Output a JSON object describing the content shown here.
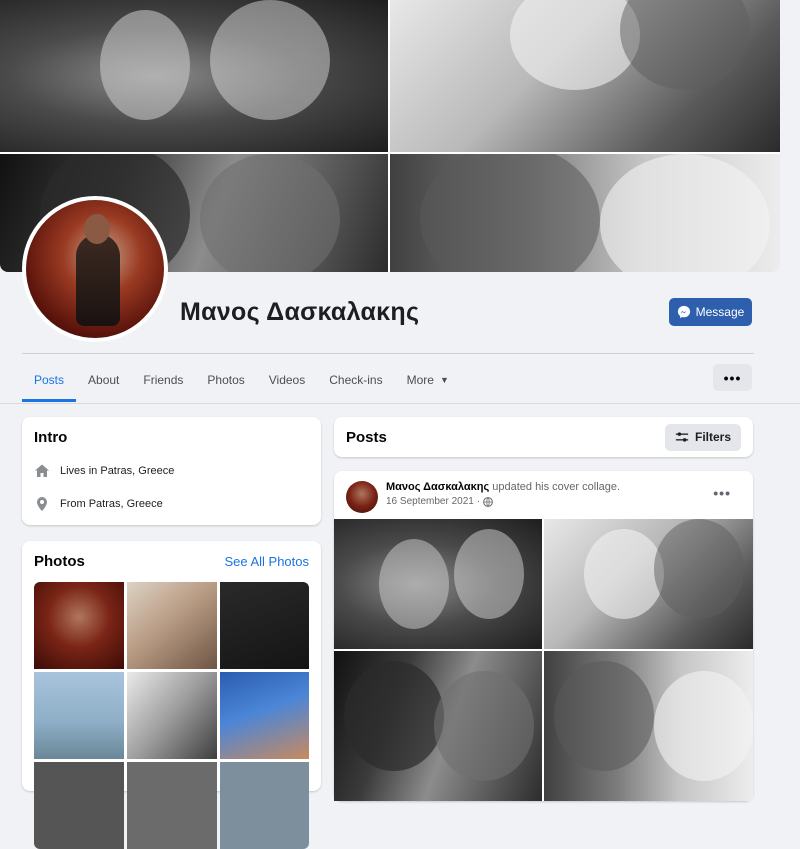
{
  "profile": {
    "name": "Μανος Δασκαλακης",
    "message_label": "Message"
  },
  "tabs": [
    {
      "label": "Posts",
      "active": true
    },
    {
      "label": "About"
    },
    {
      "label": "Friends"
    },
    {
      "label": "Photos"
    },
    {
      "label": "Videos"
    },
    {
      "label": "Check-ins"
    },
    {
      "label": "More"
    }
  ],
  "more_options_label": "•••",
  "intro": {
    "title": "Intro",
    "lives_in": "Lives in Patras, Greece",
    "from": "From Patras, Greece"
  },
  "photos": {
    "title": "Photos",
    "see_all": "See All Photos"
  },
  "posts": {
    "title": "Posts",
    "filters_label": "Filters"
  },
  "post": {
    "author": "Μανος Δασκαλακης",
    "action": "updated his cover collage.",
    "date": "16 September 2021",
    "separator": "·",
    "menu_label": "•••"
  },
  "colors": {
    "accent": "#1b74e4",
    "message_button": "#2d5fad",
    "page_bg": "#f0f2f5"
  }
}
